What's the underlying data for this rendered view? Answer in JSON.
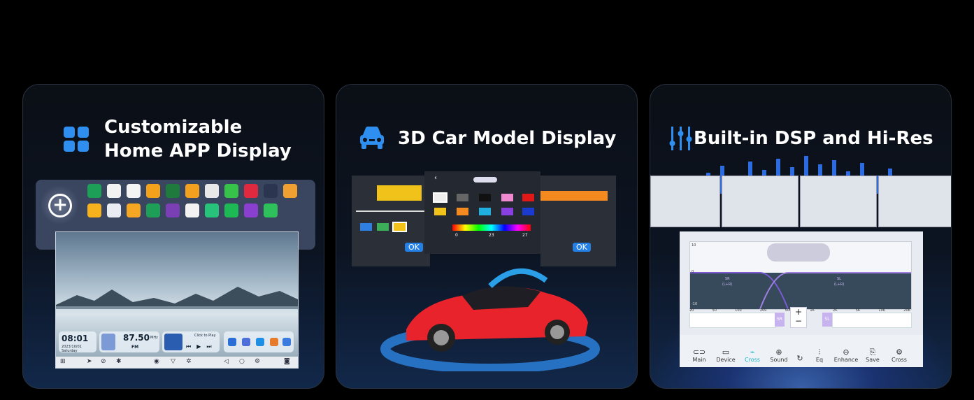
{
  "cards": [
    {
      "title_line1": "Customizable",
      "title_line2": "Home APP Display",
      "icon": "app-grid-icon",
      "clock_time": "08:01",
      "clock_date": "2023/10/01 Saturday",
      "radio_freq": "87.50",
      "radio_unit": "MHz",
      "radio_band": "FM",
      "music_label": "Click to Play"
    },
    {
      "title": "3D Car Model Display",
      "icon": "car-icon",
      "ok_label": "OK",
      "color_scale_min": "0",
      "color_scale_mid": "23",
      "color_scale_max": "27"
    },
    {
      "title": "Built-in DSP and Hi-Res",
      "icon": "equalizer-icon",
      "dsp_left_label": "SR",
      "dsp_left_sub": "(L+R)",
      "dsp_right_label": "SL",
      "dsp_right_sub": "(L+R)",
      "y_top": "10",
      "y_mid": "0",
      "y_bot": "-10",
      "freq_ticks": [
        "20",
        "50",
        "100",
        "200",
        "500",
        "1K",
        "2K",
        "5K",
        "10K",
        "20K"
      ],
      "plus": "+",
      "minus": "−",
      "chan_sr": "SR",
      "chan_sl": "SL",
      "tabs": [
        {
          "label": "Main",
          "icon": "car-front-icon"
        },
        {
          "label": "Device",
          "icon": "device-icon"
        },
        {
          "label": "Cross",
          "icon": "cross-icon",
          "active": true
        },
        {
          "label": "Sound",
          "icon": "sound-icon"
        },
        {
          "label": "",
          "icon": "reset-icon"
        },
        {
          "label": "Eq",
          "icon": "eq-icon"
        },
        {
          "label": "Enhance",
          "icon": "enhance-icon"
        },
        {
          "label": "Save",
          "icon": "save-icon"
        },
        {
          "label": "Cross",
          "icon": "settings-icon"
        }
      ]
    }
  ],
  "colors": {
    "accent_blue": "#2f8ff0",
    "bg_black": "#000000",
    "teal_active": "#19b3c6",
    "car_red": "#e8232b"
  }
}
